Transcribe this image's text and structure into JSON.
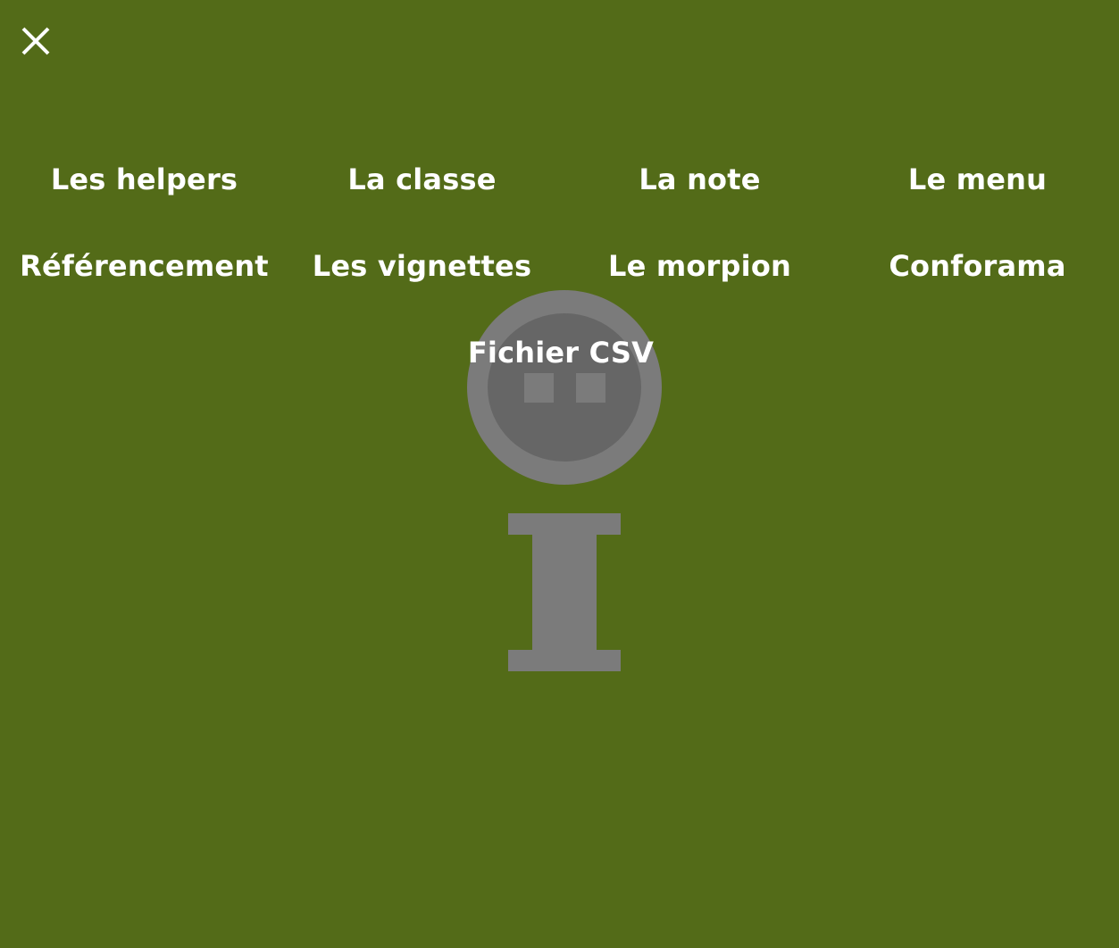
{
  "close": {
    "icon": "close-icon"
  },
  "menu": {
    "items": [
      {
        "label": "Les helpers"
      },
      {
        "label": "La classe"
      },
      {
        "label": "La note"
      },
      {
        "label": "Le menu"
      },
      {
        "label": "Référencement"
      },
      {
        "label": "Les vignettes"
      },
      {
        "label": "Le morpion"
      },
      {
        "label": "Conforama"
      },
      {
        "label": "Fichier CSV"
      }
    ]
  },
  "background": {
    "icon": "mascot-info-icon"
  },
  "colors": {
    "background": "#536b18",
    "text": "#ffffff",
    "mascot_outer": "#7b7b7b",
    "mascot_inner": "#666666"
  }
}
